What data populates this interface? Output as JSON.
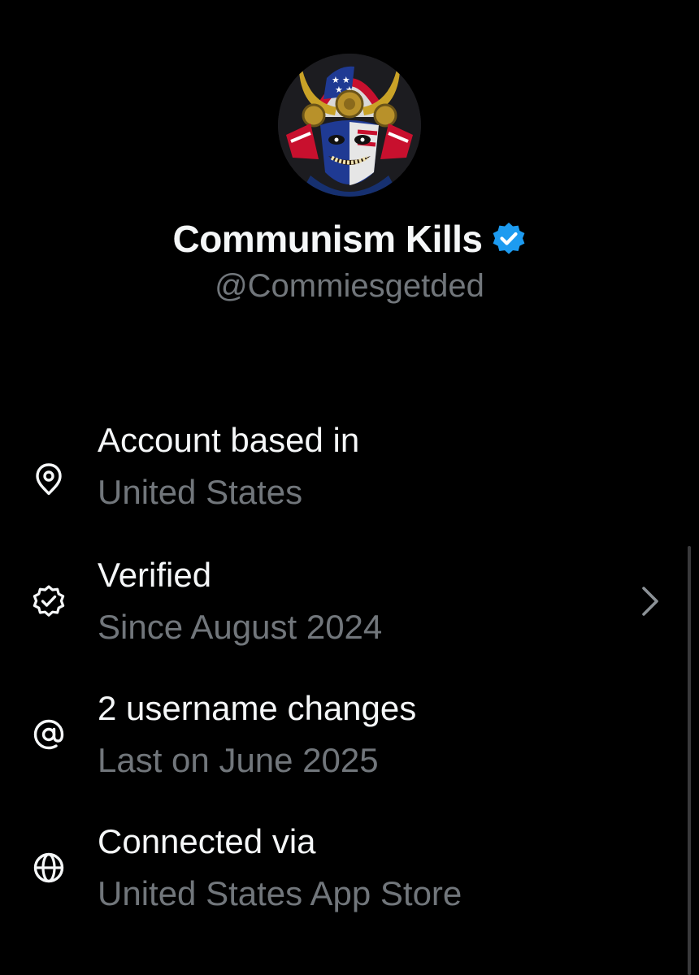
{
  "profile": {
    "display_name": "Communism Kills",
    "handle": "@Commiesgetded",
    "verified": true,
    "avatar_icon": "samurai-mask-avatar"
  },
  "rows": [
    {
      "icon": "location-pin-icon",
      "title": "Account based in",
      "subtitle": "United States",
      "has_chevron": false
    },
    {
      "icon": "verified-badge-icon",
      "title": "Verified",
      "subtitle": "Since August 2024",
      "has_chevron": true
    },
    {
      "icon": "at-sign-icon",
      "title": "2 username changes",
      "subtitle": "Last on June 2025",
      "has_chevron": false
    },
    {
      "icon": "globe-icon",
      "title": "Connected via",
      "subtitle": "United States App Store",
      "has_chevron": false
    }
  ],
  "colors": {
    "background": "#000000",
    "primary_text": "#f5f7f8",
    "secondary_text": "#71767b",
    "verified_blue": "#1d9bf0"
  }
}
